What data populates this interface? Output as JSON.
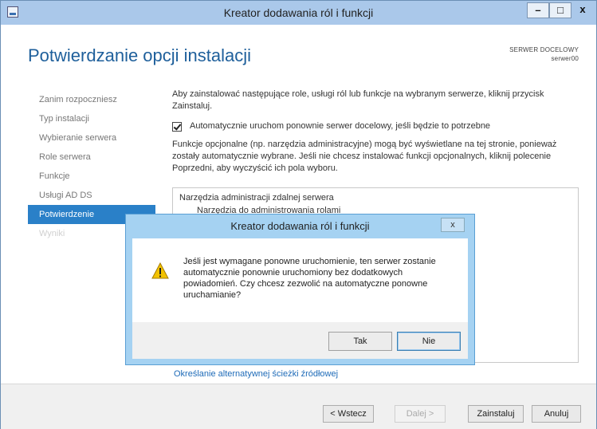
{
  "window": {
    "title": "Kreator dodawania ról i funkcji",
    "controls": {
      "minimize": "–",
      "maximize": "□",
      "close": "x"
    }
  },
  "header": {
    "title": "Potwierdzanie opcji instalacji",
    "destination_label": "SERWER DOCELOWY",
    "destination_server": "serwer00"
  },
  "nav": {
    "items": [
      {
        "label": "Zanim rozpoczniesz",
        "state": "normal"
      },
      {
        "label": "Typ instalacji",
        "state": "normal"
      },
      {
        "label": "Wybieranie serwera",
        "state": "normal"
      },
      {
        "label": "Role serwera",
        "state": "normal"
      },
      {
        "label": "Funkcje",
        "state": "normal"
      },
      {
        "label": "Usługi AD DS",
        "state": "normal"
      },
      {
        "label": "Potwierdzenie",
        "state": "active"
      },
      {
        "label": "Wyniki",
        "state": "disabled"
      }
    ]
  },
  "main": {
    "intro": "Aby zainstalować następujące role, usługi ról lub funkcje na wybranym serwerze, kliknij przycisk Zainstaluj.",
    "restart_checkbox_label": "Automatycznie uruchom ponownie serwer docelowy, jeśli będzie to potrzebne",
    "restart_checked": true,
    "optional_info": "Funkcje opcjonalne (np. narzędzia administracyjne) mogą być wyświetlane na tej stronie, ponieważ zostały automatycznie wybrane. Jeśli nie chcesz instalować funkcji opcjonalnych, kliknij polecenie Poprzedni, aby wyczyścić ich pola wyboru.",
    "results": [
      "Narzędzia administracji zdalnej serwera",
      "Narzędzia do administrowania rolami"
    ],
    "alt_source_link": "Określanie alternatywnej ścieżki źródłowej"
  },
  "footer": {
    "prev": "< Wstecz",
    "next": "Dalej >",
    "install": "Zainstaluj",
    "cancel": "Anuluj"
  },
  "dialog": {
    "title": "Kreator dodawania ról i funkcji",
    "close": "x",
    "icon": "warning-icon",
    "message": "Jeśli jest wymagane ponowne uruchomienie, ten serwer zostanie automatycznie ponownie uruchomiony bez dodatkowych powiadomień. Czy chcesz zezwolić na automatyczne ponowne uruchamianie?",
    "yes": "Tak",
    "no": "Nie"
  },
  "colors": {
    "accent": "#2a80c8",
    "title_blue": "#1e5f9b",
    "titlebar": "#aac8ea",
    "dialog_frame": "#a5d2f2",
    "warning": "#f2c200"
  }
}
